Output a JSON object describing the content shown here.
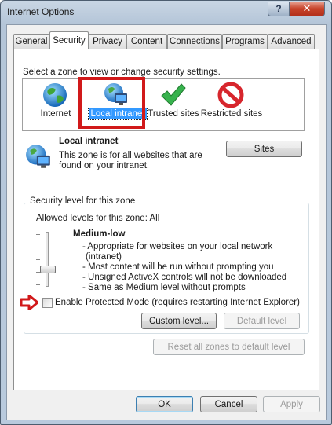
{
  "window": {
    "title": "Internet Options",
    "help_label": "?",
    "close_label": "✕"
  },
  "tabs": [
    {
      "label": "General"
    },
    {
      "label": "Security"
    },
    {
      "label": "Privacy"
    },
    {
      "label": "Content"
    },
    {
      "label": "Connections"
    },
    {
      "label": "Programs"
    },
    {
      "label": "Advanced"
    }
  ],
  "security": {
    "zone_prompt": "Select a zone to view or change security settings.",
    "zones": [
      {
        "label": "Internet",
        "icon": "globe-icon"
      },
      {
        "label": "Local intranet",
        "icon": "intranet-icon"
      },
      {
        "label": "Trusted sites",
        "icon": "checkmark-icon"
      },
      {
        "label": "Restricted sites",
        "icon": "prohibited-icon"
      }
    ],
    "selected_zone": {
      "title": "Local intranet",
      "description_line1": "This zone is for all websites that are",
      "description_line2": "found on your intranet.",
      "sites_button": "Sites"
    },
    "level_group_title": "Security level for this zone",
    "allowed_levels": "Allowed levels for this zone: All",
    "level_name": "Medium-low",
    "level_level_fraction": 0.5,
    "level_description": [
      "- Appropriate for websites on your local network",
      "(intranet)",
      "- Most content will be run without prompting you",
      "- Unsigned ActiveX controls will not be downloaded",
      "- Same as Medium level without prompts"
    ],
    "protected_mode_label": "Enable Protected Mode (requires restarting Internet Explorer)",
    "protected_mode_checked": false,
    "custom_level_button": "Custom level...",
    "default_level_button": "Default level",
    "reset_all_button": "Reset all zones to default level"
  },
  "footer": {
    "ok": "OK",
    "cancel": "Cancel",
    "apply": "Apply"
  },
  "colors": {
    "highlight_frame": "#d1191a",
    "selection": "#3399ff",
    "arrow": "#d1191a"
  }
}
